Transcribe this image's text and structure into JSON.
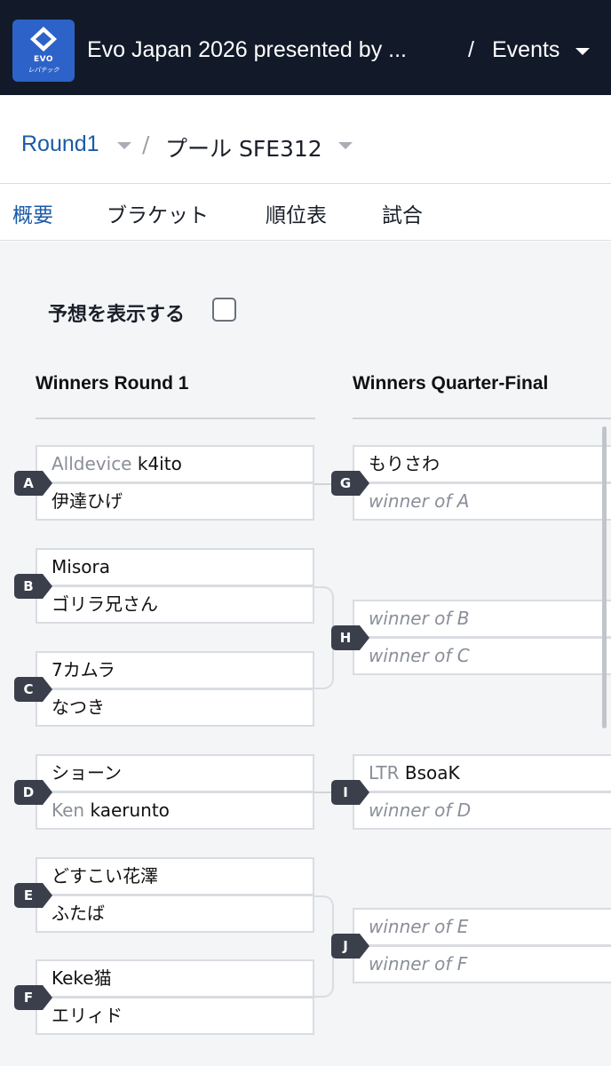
{
  "header": {
    "logo_text": "EVO",
    "logo_subtext": "レバテック",
    "title": "Evo Japan 2026 presented by ...",
    "separator": "/",
    "events_label": "Events"
  },
  "breadcrumb": {
    "round_label": "Round1",
    "separator": "/",
    "pool_label": "プール SFE312"
  },
  "tabs": [
    {
      "label": "概要",
      "active": true
    },
    {
      "label": "ブラケット",
      "active": false
    },
    {
      "label": "順位表",
      "active": false
    },
    {
      "label": "試合",
      "active": false
    }
  ],
  "predictions": {
    "label": "予想を表示する",
    "checked": false
  },
  "columns": {
    "round1": "Winners Round 1",
    "quarter": "Winners Quarter-Final"
  },
  "round1_matches": [
    {
      "id": "A",
      "p1_prefix": "Alldevice",
      "p1": "k4ito",
      "p2_prefix": "",
      "p2": "伊達ひげ"
    },
    {
      "id": "B",
      "p1_prefix": "",
      "p1": "Misora",
      "p2_prefix": "",
      "p2": "ゴリラ兄さん"
    },
    {
      "id": "C",
      "p1_prefix": "",
      "p1": "7カムラ",
      "p2_prefix": "",
      "p2": "なつき"
    },
    {
      "id": "D",
      "p1_prefix": "",
      "p1": "ショーン",
      "p2_prefix": "Ken",
      "p2": "kaerunto"
    },
    {
      "id": "E",
      "p1_prefix": "",
      "p1": "どすこい花澤",
      "p2_prefix": "",
      "p2": "ふたば"
    },
    {
      "id": "F",
      "p1_prefix": "",
      "p1": "Keke猫",
      "p2_prefix": "",
      "p2": "エリィド"
    }
  ],
  "quarter_matches": [
    {
      "id": "G",
      "p1_prefix": "",
      "p1": "もりさわ",
      "p2": "winner of A"
    },
    {
      "id": "H",
      "p1": "winner of B",
      "p2": "winner of C"
    },
    {
      "id": "I",
      "p1_prefix": "LTR",
      "p1": "BsoaK",
      "p2": "winner of D"
    },
    {
      "id": "J",
      "p1": "winner of E",
      "p2": "winner of F"
    }
  ],
  "colors": {
    "header_bg": "#121a29",
    "accent_blue": "#1a5aa8",
    "badge_bg": "#3a3f4b",
    "content_bg": "#f4f5f7"
  }
}
